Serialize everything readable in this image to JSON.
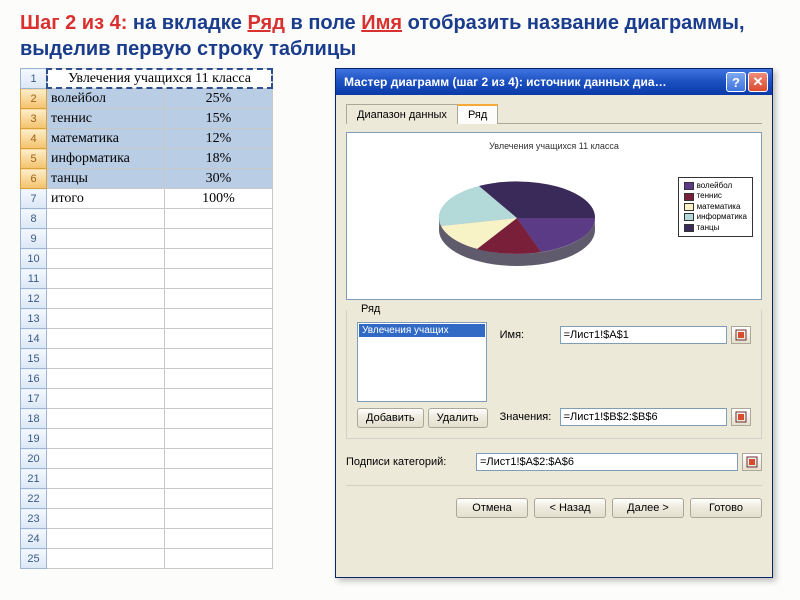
{
  "heading": {
    "step_prefix": "Шаг 2 из 4:",
    "part1": " на вкладке ",
    "link1": "Ряд",
    "part2": " в поле ",
    "link2": "Имя",
    "part3": " отобразить название диаграммы, выделив первую строку таблицы"
  },
  "sheet": {
    "title_cell": "Увлечения учащихся 11 класса",
    "rows": [
      {
        "n": "2",
        "a": "волейбол",
        "b": "25%"
      },
      {
        "n": "3",
        "a": "теннис",
        "b": "15%"
      },
      {
        "n": "4",
        "a": "математика",
        "b": "12%"
      },
      {
        "n": "5",
        "a": "информатика",
        "b": "18%"
      },
      {
        "n": "6",
        "a": "танцы",
        "b": "30%"
      }
    ],
    "total": {
      "n": "7",
      "a": "итого",
      "b": "100%"
    },
    "empty": [
      "8",
      "9",
      "10",
      "11",
      "12",
      "13",
      "14",
      "15",
      "16",
      "17",
      "18",
      "19",
      "20",
      "21",
      "22",
      "23",
      "24",
      "25"
    ]
  },
  "dialog": {
    "title": "Мастер диаграмм (шаг 2 из 4): источник данных диа…",
    "tabs": {
      "data_range": "Диапазон данных",
      "series": "Ряд"
    },
    "chart_title": "Увлечения учащихся 11 класса",
    "legend_items": [
      {
        "label": "волейбол",
        "color": "#5b3a86"
      },
      {
        "label": "теннис",
        "color": "#7a1f3a"
      },
      {
        "label": "математика",
        "color": "#f8f2c7"
      },
      {
        "label": "информатика",
        "color": "#b3d9d9"
      },
      {
        "label": "танцы",
        "color": "#3a2a5a"
      }
    ],
    "series_label": "Ряд",
    "series_item": "Увлечения учащих",
    "name_label": "Имя:",
    "name_value": "=Лист1!$A$1",
    "values_label": "Значения:",
    "values_value": "=Лист1!$B$2:$B$6",
    "add": "Добавить",
    "remove": "Удалить",
    "catlabels": "Подписи категорий:",
    "cat_value": "=Лист1!$A$2:$A$6",
    "buttons": {
      "cancel": "Отмена",
      "back": "< Назад",
      "next": "Далее >",
      "finish": "Готово"
    }
  },
  "chart_data": {
    "type": "pie",
    "title": "Увлечения учащихся 11 класса",
    "categories": [
      "волейбол",
      "теннис",
      "математика",
      "информатика",
      "танцы"
    ],
    "values": [
      25,
      15,
      12,
      18,
      30
    ],
    "series": [
      {
        "name": "Увлечения учащихся 11 класса",
        "values": [
          25,
          15,
          12,
          18,
          30
        ]
      }
    ]
  }
}
